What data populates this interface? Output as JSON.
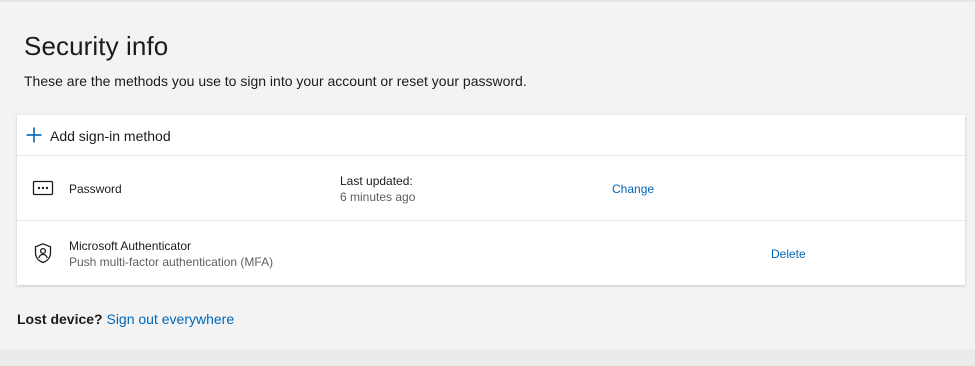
{
  "header": {
    "title": "Security info",
    "subtitle": "These are the methods you use to sign into your account or reset your password."
  },
  "add_method": {
    "icon": "plus-icon",
    "label": "Add sign-in method"
  },
  "methods": [
    {
      "icon": "password-icon",
      "name": "Password",
      "detail_label": "Last updated:",
      "detail_value": "6 minutes ago",
      "action": "Change"
    },
    {
      "icon": "authenticator-app-icon",
      "name": "Microsoft Authenticator",
      "description": "Push multi-factor authentication (MFA)",
      "action": "Delete"
    }
  ],
  "footer": {
    "lost_device_label": "Lost device?",
    "sign_out_link": "Sign out everywhere"
  },
  "colors": {
    "link": "#0067b8",
    "background": "#f3f3f3",
    "card": "#ffffff",
    "text": "#1b1b1b",
    "secondary_text": "#5f5f5f"
  }
}
